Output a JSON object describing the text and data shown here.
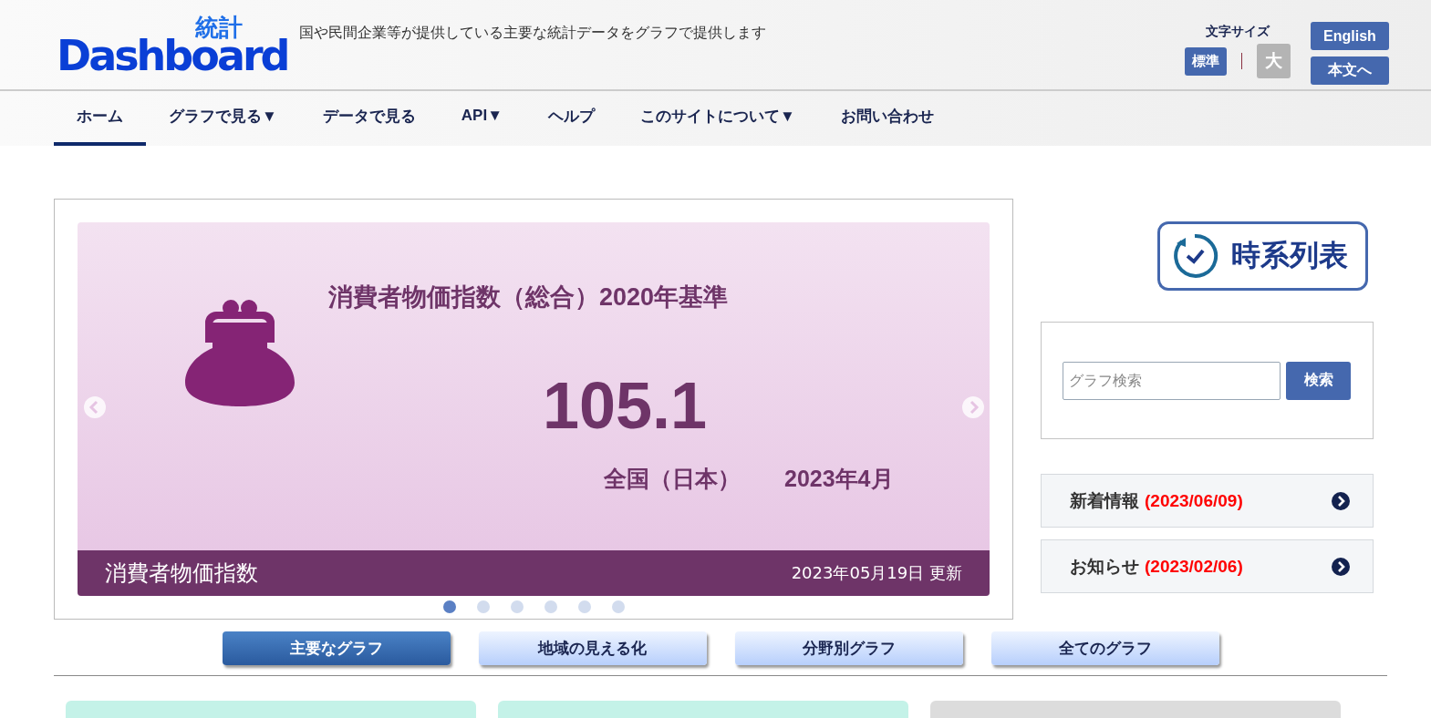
{
  "header": {
    "logo": {
      "kanji": "統計",
      "wordmark": "Dashboard"
    },
    "tagline": "国や民間企業等が提供している主要な統計データをグラフで提供します",
    "font_size": {
      "label": "文字サイズ",
      "options": [
        {
          "label": "標準",
          "selected": true
        },
        {
          "label": "大",
          "selected": false
        }
      ]
    },
    "buttons": [
      "English",
      "本文へ"
    ]
  },
  "nav": [
    {
      "label": "ホーム",
      "selected": true
    },
    {
      "label": "グラフで見る▼",
      "selected": false
    },
    {
      "label": "データで見る",
      "selected": false
    },
    {
      "label": "API▼",
      "selected": false
    },
    {
      "label": "ヘルプ",
      "selected": false
    },
    {
      "label": "このサイトについて▼",
      "selected": false
    },
    {
      "label": "お問い合わせ",
      "selected": false
    }
  ],
  "carousel": {
    "slide": {
      "title": "消費者物価指数（総合）2020年基準",
      "value": "105.1",
      "region": "全国（日本）",
      "period": "2023年4月",
      "category": "消費者物価指数",
      "updated": "2023年05月19日 更新"
    },
    "dots": [
      {
        "selected": true
      },
      {
        "selected": false
      },
      {
        "selected": false
      },
      {
        "selected": false
      },
      {
        "selected": false
      },
      {
        "selected": false
      }
    ]
  },
  "sidebar": {
    "timeseries_button": "時系列表",
    "search": {
      "placeholder": "グラフ検索",
      "button": "検索"
    },
    "links": [
      {
        "label": "新着情報",
        "date": "(2023/06/09)"
      },
      {
        "label": "お知らせ",
        "date": "(2023/02/06)"
      }
    ]
  },
  "graph_tabs": [
    {
      "label": "主要なグラフ",
      "selected": true
    },
    {
      "label": "地域の見える化",
      "selected": false
    },
    {
      "label": "分野別グラフ",
      "selected": false
    },
    {
      "label": "全てのグラフ",
      "selected": false
    }
  ],
  "cards": [
    {
      "color": "#c4f2e8"
    },
    {
      "color": "#c4f2e8"
    },
    {
      "color": "#dcdcdc"
    }
  ]
}
